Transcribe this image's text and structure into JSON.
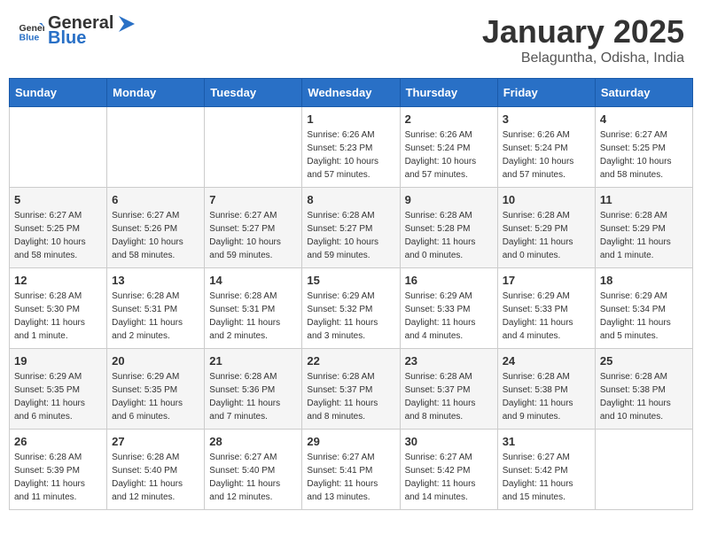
{
  "header": {
    "logo_general": "General",
    "logo_blue": "Blue",
    "month": "January 2025",
    "location": "Belaguntha, Odisha, India"
  },
  "weekdays": [
    "Sunday",
    "Monday",
    "Tuesday",
    "Wednesday",
    "Thursday",
    "Friday",
    "Saturday"
  ],
  "weeks": [
    [
      {
        "day": "",
        "sunrise": "",
        "sunset": "",
        "daylight": ""
      },
      {
        "day": "",
        "sunrise": "",
        "sunset": "",
        "daylight": ""
      },
      {
        "day": "",
        "sunrise": "",
        "sunset": "",
        "daylight": ""
      },
      {
        "day": "1",
        "sunrise": "Sunrise: 6:26 AM",
        "sunset": "Sunset: 5:23 PM",
        "daylight": "Daylight: 10 hours and 57 minutes."
      },
      {
        "day": "2",
        "sunrise": "Sunrise: 6:26 AM",
        "sunset": "Sunset: 5:24 PM",
        "daylight": "Daylight: 10 hours and 57 minutes."
      },
      {
        "day": "3",
        "sunrise": "Sunrise: 6:26 AM",
        "sunset": "Sunset: 5:24 PM",
        "daylight": "Daylight: 10 hours and 57 minutes."
      },
      {
        "day": "4",
        "sunrise": "Sunrise: 6:27 AM",
        "sunset": "Sunset: 5:25 PM",
        "daylight": "Daylight: 10 hours and 58 minutes."
      }
    ],
    [
      {
        "day": "5",
        "sunrise": "Sunrise: 6:27 AM",
        "sunset": "Sunset: 5:25 PM",
        "daylight": "Daylight: 10 hours and 58 minutes."
      },
      {
        "day": "6",
        "sunrise": "Sunrise: 6:27 AM",
        "sunset": "Sunset: 5:26 PM",
        "daylight": "Daylight: 10 hours and 58 minutes."
      },
      {
        "day": "7",
        "sunrise": "Sunrise: 6:27 AM",
        "sunset": "Sunset: 5:27 PM",
        "daylight": "Daylight: 10 hours and 59 minutes."
      },
      {
        "day": "8",
        "sunrise": "Sunrise: 6:28 AM",
        "sunset": "Sunset: 5:27 PM",
        "daylight": "Daylight: 10 hours and 59 minutes."
      },
      {
        "day": "9",
        "sunrise": "Sunrise: 6:28 AM",
        "sunset": "Sunset: 5:28 PM",
        "daylight": "Daylight: 11 hours and 0 minutes."
      },
      {
        "day": "10",
        "sunrise": "Sunrise: 6:28 AM",
        "sunset": "Sunset: 5:29 PM",
        "daylight": "Daylight: 11 hours and 0 minutes."
      },
      {
        "day": "11",
        "sunrise": "Sunrise: 6:28 AM",
        "sunset": "Sunset: 5:29 PM",
        "daylight": "Daylight: 11 hours and 1 minute."
      }
    ],
    [
      {
        "day": "12",
        "sunrise": "Sunrise: 6:28 AM",
        "sunset": "Sunset: 5:30 PM",
        "daylight": "Daylight: 11 hours and 1 minute."
      },
      {
        "day": "13",
        "sunrise": "Sunrise: 6:28 AM",
        "sunset": "Sunset: 5:31 PM",
        "daylight": "Daylight: 11 hours and 2 minutes."
      },
      {
        "day": "14",
        "sunrise": "Sunrise: 6:28 AM",
        "sunset": "Sunset: 5:31 PM",
        "daylight": "Daylight: 11 hours and 2 minutes."
      },
      {
        "day": "15",
        "sunrise": "Sunrise: 6:29 AM",
        "sunset": "Sunset: 5:32 PM",
        "daylight": "Daylight: 11 hours and 3 minutes."
      },
      {
        "day": "16",
        "sunrise": "Sunrise: 6:29 AM",
        "sunset": "Sunset: 5:33 PM",
        "daylight": "Daylight: 11 hours and 4 minutes."
      },
      {
        "day": "17",
        "sunrise": "Sunrise: 6:29 AM",
        "sunset": "Sunset: 5:33 PM",
        "daylight": "Daylight: 11 hours and 4 minutes."
      },
      {
        "day": "18",
        "sunrise": "Sunrise: 6:29 AM",
        "sunset": "Sunset: 5:34 PM",
        "daylight": "Daylight: 11 hours and 5 minutes."
      }
    ],
    [
      {
        "day": "19",
        "sunrise": "Sunrise: 6:29 AM",
        "sunset": "Sunset: 5:35 PM",
        "daylight": "Daylight: 11 hours and 6 minutes."
      },
      {
        "day": "20",
        "sunrise": "Sunrise: 6:29 AM",
        "sunset": "Sunset: 5:35 PM",
        "daylight": "Daylight: 11 hours and 6 minutes."
      },
      {
        "day": "21",
        "sunrise": "Sunrise: 6:28 AM",
        "sunset": "Sunset: 5:36 PM",
        "daylight": "Daylight: 11 hours and 7 minutes."
      },
      {
        "day": "22",
        "sunrise": "Sunrise: 6:28 AM",
        "sunset": "Sunset: 5:37 PM",
        "daylight": "Daylight: 11 hours and 8 minutes."
      },
      {
        "day": "23",
        "sunrise": "Sunrise: 6:28 AM",
        "sunset": "Sunset: 5:37 PM",
        "daylight": "Daylight: 11 hours and 8 minutes."
      },
      {
        "day": "24",
        "sunrise": "Sunrise: 6:28 AM",
        "sunset": "Sunset: 5:38 PM",
        "daylight": "Daylight: 11 hours and 9 minutes."
      },
      {
        "day": "25",
        "sunrise": "Sunrise: 6:28 AM",
        "sunset": "Sunset: 5:38 PM",
        "daylight": "Daylight: 11 hours and 10 minutes."
      }
    ],
    [
      {
        "day": "26",
        "sunrise": "Sunrise: 6:28 AM",
        "sunset": "Sunset: 5:39 PM",
        "daylight": "Daylight: 11 hours and 11 minutes."
      },
      {
        "day": "27",
        "sunrise": "Sunrise: 6:28 AM",
        "sunset": "Sunset: 5:40 PM",
        "daylight": "Daylight: 11 hours and 12 minutes."
      },
      {
        "day": "28",
        "sunrise": "Sunrise: 6:27 AM",
        "sunset": "Sunset: 5:40 PM",
        "daylight": "Daylight: 11 hours and 12 minutes."
      },
      {
        "day": "29",
        "sunrise": "Sunrise: 6:27 AM",
        "sunset": "Sunset: 5:41 PM",
        "daylight": "Daylight: 11 hours and 13 minutes."
      },
      {
        "day": "30",
        "sunrise": "Sunrise: 6:27 AM",
        "sunset": "Sunset: 5:42 PM",
        "daylight": "Daylight: 11 hours and 14 minutes."
      },
      {
        "day": "31",
        "sunrise": "Sunrise: 6:27 AM",
        "sunset": "Sunset: 5:42 PM",
        "daylight": "Daylight: 11 hours and 15 minutes."
      },
      {
        "day": "",
        "sunrise": "",
        "sunset": "",
        "daylight": ""
      }
    ]
  ]
}
